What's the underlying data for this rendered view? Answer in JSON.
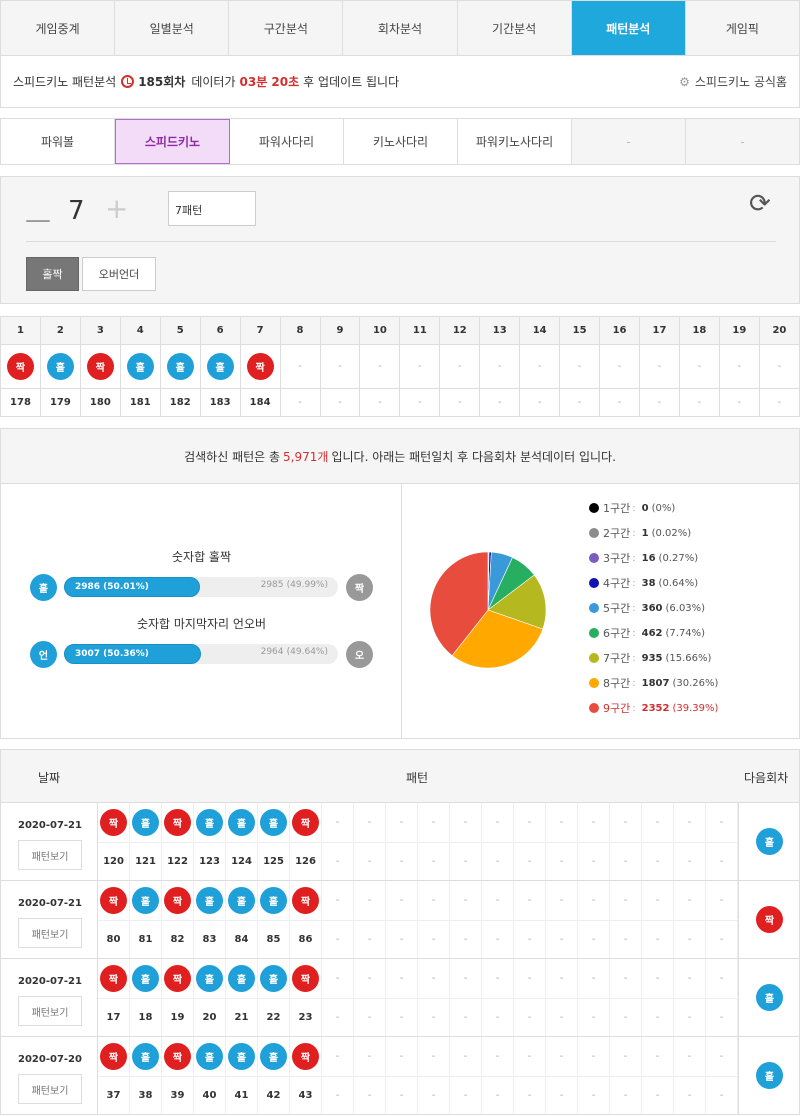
{
  "topnav": [
    "게임중계",
    "일별분석",
    "구간분석",
    "회차분석",
    "기간분석",
    "패턴분석",
    "게임픽"
  ],
  "info": {
    "title": "스피드키노 패턴분석",
    "round": "185회차",
    "text1": "데이터가",
    "time": "03분 20초",
    "text2": "후 업데이트 됩니다",
    "home": "스피드키노 공식홈"
  },
  "gametabs": [
    "파워볼",
    "스피드키노",
    "파워사다리",
    "키노사다리",
    "파워키노사다리",
    "-",
    "-"
  ],
  "controls": {
    "minus": "—",
    "count": "7",
    "plus": "+",
    "select": "7패턴",
    "btn_oddeven": "홀짝",
    "btn_overunder": "오버언더"
  },
  "pattern": {
    "cols": [
      "1",
      "2",
      "3",
      "4",
      "5",
      "6",
      "7",
      "8",
      "9",
      "10",
      "11",
      "12",
      "13",
      "14",
      "15",
      "16",
      "17",
      "18",
      "19",
      "20"
    ],
    "balls": [
      "짝",
      "홀",
      "짝",
      "홀",
      "홀",
      "홀",
      "짝"
    ],
    "ball_colors": [
      "red",
      "blue",
      "red",
      "blue",
      "blue",
      "blue",
      "red"
    ],
    "nums": [
      "178",
      "179",
      "180",
      "181",
      "182",
      "183",
      "184"
    ],
    "empty": "-"
  },
  "summary": {
    "pre": "검색하신 패턴은 총",
    "count": "5,971개",
    "post": "입니다. 아래는 패턴일치 후 다음회차 분석데이터 입니다."
  },
  "stats": {
    "oddeven": {
      "title": "숫자합 홀짝",
      "left_ball": "홀",
      "right_ball": "짝",
      "left_val": "2986 (50.01%)",
      "right_val": "2985",
      "right_pct": "(49.99%)",
      "fraction": 0.5001
    },
    "overunder": {
      "title": "숫자합 마지막자리 언오버",
      "left_ball": "언",
      "right_ball": "오",
      "left_val": "3007 (50.36%)",
      "right_val": "2964",
      "right_pct": "(49.64%)",
      "fraction": 0.5036
    }
  },
  "chart_data": {
    "type": "pie",
    "slices": [
      {
        "label": "1구간",
        "value": 0,
        "pct": "(0%)",
        "color": "#000000"
      },
      {
        "label": "2구간",
        "value": 1,
        "pct": "(0.02%)",
        "color": "#8c8c8c"
      },
      {
        "label": "3구간",
        "value": 16,
        "pct": "(0.27%)",
        "color": "#7b5cc0"
      },
      {
        "label": "4구간",
        "value": 38,
        "pct": "(0.64%)",
        "color": "#1212b0"
      },
      {
        "label": "5구간",
        "value": 360,
        "pct": "(6.03%)",
        "color": "#3a99d8"
      },
      {
        "label": "6구간",
        "value": 462,
        "pct": "(7.74%)",
        "color": "#27ae60"
      },
      {
        "label": "7구간",
        "value": 935,
        "pct": "(15.66%)",
        "color": "#b6b820"
      },
      {
        "label": "8구간",
        "value": 1807,
        "pct": "(30.26%)",
        "color": "#ffa800"
      },
      {
        "label": "9구간",
        "value": 2352,
        "pct": "(39.39%)",
        "color": "#e74c3c"
      }
    ],
    "highlight": "9구간"
  },
  "history": {
    "headers": {
      "date": "날짜",
      "pattern": "패턴",
      "next": "다음회차"
    },
    "button": "패턴보기",
    "rows": [
      {
        "date": "2020-07-21",
        "balls": [
          "짝",
          "홀",
          "짝",
          "홀",
          "홀",
          "홀",
          "짝"
        ],
        "colors": [
          "red",
          "blue",
          "red",
          "blue",
          "blue",
          "blue",
          "red"
        ],
        "nums": [
          "120",
          "121",
          "122",
          "123",
          "124",
          "125",
          "126"
        ],
        "next": "홀",
        "next_color": "blue"
      },
      {
        "date": "2020-07-21",
        "balls": [
          "짝",
          "홀",
          "짝",
          "홀",
          "홀",
          "홀",
          "짝"
        ],
        "colors": [
          "red",
          "blue",
          "red",
          "blue",
          "blue",
          "blue",
          "red"
        ],
        "nums": [
          "80",
          "81",
          "82",
          "83",
          "84",
          "85",
          "86"
        ],
        "next": "짝",
        "next_color": "red"
      },
      {
        "date": "2020-07-21",
        "balls": [
          "짝",
          "홀",
          "짝",
          "홀",
          "홀",
          "홀",
          "짝"
        ],
        "colors": [
          "red",
          "blue",
          "red",
          "blue",
          "blue",
          "blue",
          "red"
        ],
        "nums": [
          "17",
          "18",
          "19",
          "20",
          "21",
          "22",
          "23"
        ],
        "next": "홀",
        "next_color": "blue"
      },
      {
        "date": "2020-07-20",
        "balls": [
          "짝",
          "홀",
          "짝",
          "홀",
          "홀",
          "홀",
          "짝"
        ],
        "colors": [
          "red",
          "blue",
          "red",
          "blue",
          "blue",
          "blue",
          "red"
        ],
        "nums": [
          "37",
          "38",
          "39",
          "40",
          "41",
          "42",
          "43"
        ],
        "next": "홀",
        "next_color": "blue"
      }
    ]
  }
}
